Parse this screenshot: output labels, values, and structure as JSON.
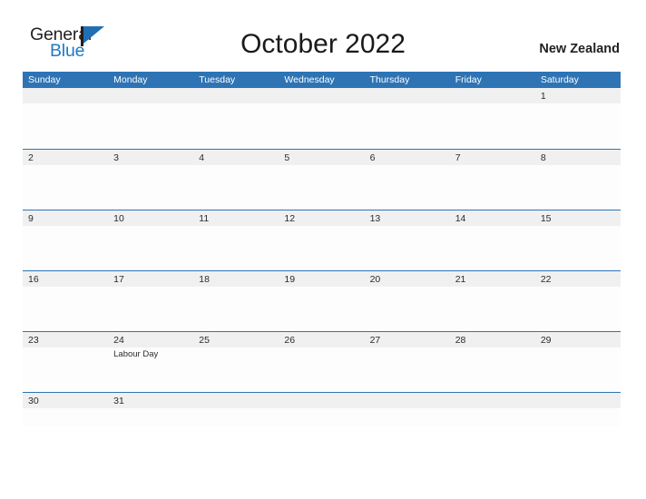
{
  "brand": {
    "name_part1": "General",
    "name_part2": "Blue",
    "flag_icon": "flag-icon",
    "color_dark": "#231f20",
    "color_blue": "#1f7ac4"
  },
  "header": {
    "title": "October 2022",
    "region": "New Zealand"
  },
  "theme": {
    "header_bar_color": "#2e74b5",
    "row_divider_color": "#2e74b5",
    "date_band_color": "#f0f0f0",
    "cell_background": "#fdfdfd",
    "text_color": "#2b2b2b"
  },
  "calendar": {
    "weekdays": [
      "Sunday",
      "Monday",
      "Tuesday",
      "Wednesday",
      "Thursday",
      "Friday",
      "Saturday"
    ],
    "weeks": [
      {
        "days": [
          {
            "number": "",
            "event": ""
          },
          {
            "number": "",
            "event": ""
          },
          {
            "number": "",
            "event": ""
          },
          {
            "number": "",
            "event": ""
          },
          {
            "number": "",
            "event": ""
          },
          {
            "number": "",
            "event": ""
          },
          {
            "number": "1",
            "event": ""
          }
        ]
      },
      {
        "days": [
          {
            "number": "2",
            "event": ""
          },
          {
            "number": "3",
            "event": ""
          },
          {
            "number": "4",
            "event": ""
          },
          {
            "number": "5",
            "event": ""
          },
          {
            "number": "6",
            "event": ""
          },
          {
            "number": "7",
            "event": ""
          },
          {
            "number": "8",
            "event": ""
          }
        ]
      },
      {
        "days": [
          {
            "number": "9",
            "event": ""
          },
          {
            "number": "10",
            "event": ""
          },
          {
            "number": "11",
            "event": ""
          },
          {
            "number": "12",
            "event": ""
          },
          {
            "number": "13",
            "event": ""
          },
          {
            "number": "14",
            "event": ""
          },
          {
            "number": "15",
            "event": ""
          }
        ]
      },
      {
        "days": [
          {
            "number": "16",
            "event": ""
          },
          {
            "number": "17",
            "event": ""
          },
          {
            "number": "18",
            "event": ""
          },
          {
            "number": "19",
            "event": ""
          },
          {
            "number": "20",
            "event": ""
          },
          {
            "number": "21",
            "event": ""
          },
          {
            "number": "22",
            "event": ""
          }
        ]
      },
      {
        "days": [
          {
            "number": "23",
            "event": ""
          },
          {
            "number": "24",
            "event": "Labour Day"
          },
          {
            "number": "25",
            "event": ""
          },
          {
            "number": "26",
            "event": ""
          },
          {
            "number": "27",
            "event": ""
          },
          {
            "number": "28",
            "event": ""
          },
          {
            "number": "29",
            "event": ""
          }
        ]
      },
      {
        "days": [
          {
            "number": "30",
            "event": ""
          },
          {
            "number": "31",
            "event": ""
          },
          {
            "number": "",
            "event": ""
          },
          {
            "number": "",
            "event": ""
          },
          {
            "number": "",
            "event": ""
          },
          {
            "number": "",
            "event": ""
          },
          {
            "number": "",
            "event": ""
          }
        ]
      }
    ]
  }
}
